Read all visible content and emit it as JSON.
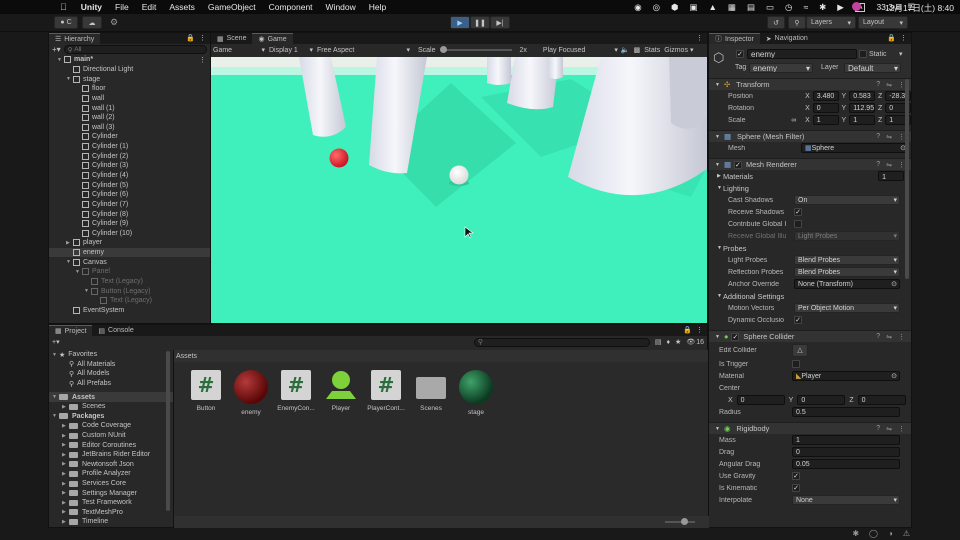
{
  "menubar": {
    "app": "Unity",
    "menus": [
      "File",
      "Edit",
      "Assets",
      "GameObject",
      "Component",
      "Window",
      "Help"
    ],
    "status": {
      "memory": "33.3",
      "memory_unit": "MB",
      "date": "12月17日(土)",
      "time": "8:40",
      "input": "A"
    }
  },
  "toolbar": {
    "account": "C",
    "layers": "Layers",
    "layout": "Layout"
  },
  "hierarchy": {
    "tab": "Hierarchy",
    "search_placeholder": "All",
    "items": [
      {
        "label": "main*",
        "depth": 0,
        "fold": "open",
        "selected": false,
        "dim": false
      },
      {
        "label": "Directional Light",
        "depth": 1,
        "fold": "none",
        "dim": false
      },
      {
        "label": "stage",
        "depth": 1,
        "fold": "open",
        "dim": false
      },
      {
        "label": "floor",
        "depth": 2,
        "fold": "none",
        "dim": false
      },
      {
        "label": "wall",
        "depth": 2,
        "fold": "none",
        "dim": false
      },
      {
        "label": "wall (1)",
        "depth": 2,
        "fold": "none",
        "dim": false
      },
      {
        "label": "wall (2)",
        "depth": 2,
        "fold": "none",
        "dim": false
      },
      {
        "label": "wall (3)",
        "depth": 2,
        "fold": "none",
        "dim": false
      },
      {
        "label": "Cylinder",
        "depth": 2,
        "fold": "none",
        "dim": false
      },
      {
        "label": "Cylinder (1)",
        "depth": 2,
        "fold": "none",
        "dim": false
      },
      {
        "label": "Cylinder (2)",
        "depth": 2,
        "fold": "none",
        "dim": false
      },
      {
        "label": "Cylinder (3)",
        "depth": 2,
        "fold": "none",
        "dim": false
      },
      {
        "label": "Cylinder (4)",
        "depth": 2,
        "fold": "none",
        "dim": false
      },
      {
        "label": "Cylinder (5)",
        "depth": 2,
        "fold": "none",
        "dim": false
      },
      {
        "label": "Cylinder (6)",
        "depth": 2,
        "fold": "none",
        "dim": false
      },
      {
        "label": "Cylinder (7)",
        "depth": 2,
        "fold": "none",
        "dim": false
      },
      {
        "label": "Cylinder (8)",
        "depth": 2,
        "fold": "none",
        "dim": false
      },
      {
        "label": "Cylinder (9)",
        "depth": 2,
        "fold": "none",
        "dim": false
      },
      {
        "label": "Cylinder (10)",
        "depth": 2,
        "fold": "none",
        "dim": false
      },
      {
        "label": "player",
        "depth": 1,
        "fold": "closed",
        "dim": false
      },
      {
        "label": "enemy",
        "depth": 1,
        "fold": "none",
        "selected": true,
        "dim": false
      },
      {
        "label": "Canvas",
        "depth": 1,
        "fold": "open",
        "dim": false
      },
      {
        "label": "Panel",
        "depth": 2,
        "fold": "open",
        "dim": true
      },
      {
        "label": "Text (Legacy)",
        "depth": 3,
        "fold": "none",
        "dim": true
      },
      {
        "label": "Button (Legacy)",
        "depth": 3,
        "fold": "open",
        "dim": true
      },
      {
        "label": "Text (Legacy)",
        "depth": 4,
        "fold": "none",
        "dim": true
      },
      {
        "label": "EventSystem",
        "depth": 1,
        "fold": "none",
        "dim": false
      }
    ]
  },
  "scene_tabs": {
    "scene": "Scene",
    "game": "Game"
  },
  "game_bar": {
    "mode": "Game",
    "display": "Display 1",
    "aspect": "Free Aspect",
    "scale_label": "Scale",
    "scale_value": "2x",
    "play_focused": "Play Focused",
    "stats": "Stats",
    "gizmos": "Gizmos"
  },
  "inspector": {
    "tabs": [
      "Inspector",
      "Navigation"
    ],
    "object_name": "enemy",
    "static": "Static",
    "tag_label": "Tag",
    "tag": "enemy",
    "layer_label": "Layer",
    "layer": "Default",
    "transform": {
      "title": "Transform",
      "position_label": "Position",
      "position": {
        "x": "3.480",
        "y": "0.583",
        "z": "-28.39"
      },
      "rotation_label": "Rotation",
      "rotation": {
        "x": "0",
        "y": "112.95",
        "z": "0"
      },
      "scale_label": "Scale",
      "scale": {
        "x": "1",
        "y": "1",
        "z": "1"
      }
    },
    "mesh_filter": {
      "title": "Sphere (Mesh Filter)",
      "mesh_label": "Mesh",
      "mesh": "Sphere"
    },
    "mesh_renderer": {
      "title": "Mesh Renderer",
      "materials_label": "Materials",
      "materials_count": "1",
      "lighting": "Lighting",
      "cast_shadows_label": "Cast Shadows",
      "cast_shadows": "On",
      "receive_shadows_label": "Receive Shadows",
      "contribute_gi_label": "Contribute Global I",
      "receive_gi_label": "Receive Global Illu",
      "receive_gi": "Light Probes",
      "probes": "Probes",
      "light_probes_label": "Light Probes",
      "light_probes": "Blend Probes",
      "reflection_probes_label": "Reflection Probes",
      "reflection_probes": "Blend Probes",
      "anchor_override_label": "Anchor Override",
      "anchor_override": "None (Transform)",
      "additional_settings": "Additional Settings",
      "motion_vectors_label": "Motion Vectors",
      "motion_vectors": "Per Object Motion",
      "dynamic_occlusion_label": "Dynamic Occlusio"
    },
    "sphere_collider": {
      "title": "Sphere Collider",
      "edit_collider_label": "Edit Collider",
      "is_trigger_label": "Is Trigger",
      "material_label": "Material",
      "material": "Player",
      "center_label": "Center",
      "center": {
        "x": "0",
        "y": "0",
        "z": "0"
      },
      "radius_label": "Radius",
      "radius": "0.5"
    },
    "rigidbody": {
      "title": "Rigidbody",
      "mass_label": "Mass",
      "mass": "1",
      "drag_label": "Drag",
      "drag": "0",
      "angular_drag_label": "Angular Drag",
      "angular_drag": "0.05",
      "use_gravity_label": "Use Gravity",
      "is_kinematic_label": "Is Kinematic",
      "interpolate_label": "Interpolate",
      "interpolate": "None"
    }
  },
  "project": {
    "tabs": [
      "Project",
      "Console"
    ],
    "hidden_count": "16",
    "favorites_label": "Favorites",
    "favorites": [
      "All Materials",
      "All Models",
      "All Prefabs"
    ],
    "assets_label": "Assets",
    "asset_children": [
      "Scenes"
    ],
    "packages_label": "Packages",
    "packages": [
      "Code Coverage",
      "Custom NUnit",
      "Editor Coroutines",
      "JetBrains Rider Editor",
      "Newtonsoft Json",
      "Profile Analyzer",
      "Services Core",
      "Settings Manager",
      "Test Framework",
      "TextMeshPro",
      "Timeline"
    ],
    "breadcrumb": "Assets",
    "grid": [
      {
        "name": "Button",
        "kind": "script"
      },
      {
        "name": "enemy",
        "kind": "mat-red"
      },
      {
        "name": "EnemyCon...",
        "kind": "script"
      },
      {
        "name": "Player",
        "kind": "prefab"
      },
      {
        "name": "PlayerCont...",
        "kind": "script"
      },
      {
        "name": "Scenes",
        "kind": "folder"
      },
      {
        "name": "stage",
        "kind": "mat-green"
      }
    ]
  },
  "colors": {
    "game_floor": "#3ff0bd",
    "enemy_ball": "#e0202a",
    "selection": "#3a3a3a",
    "accent_blue": "#46607c"
  }
}
